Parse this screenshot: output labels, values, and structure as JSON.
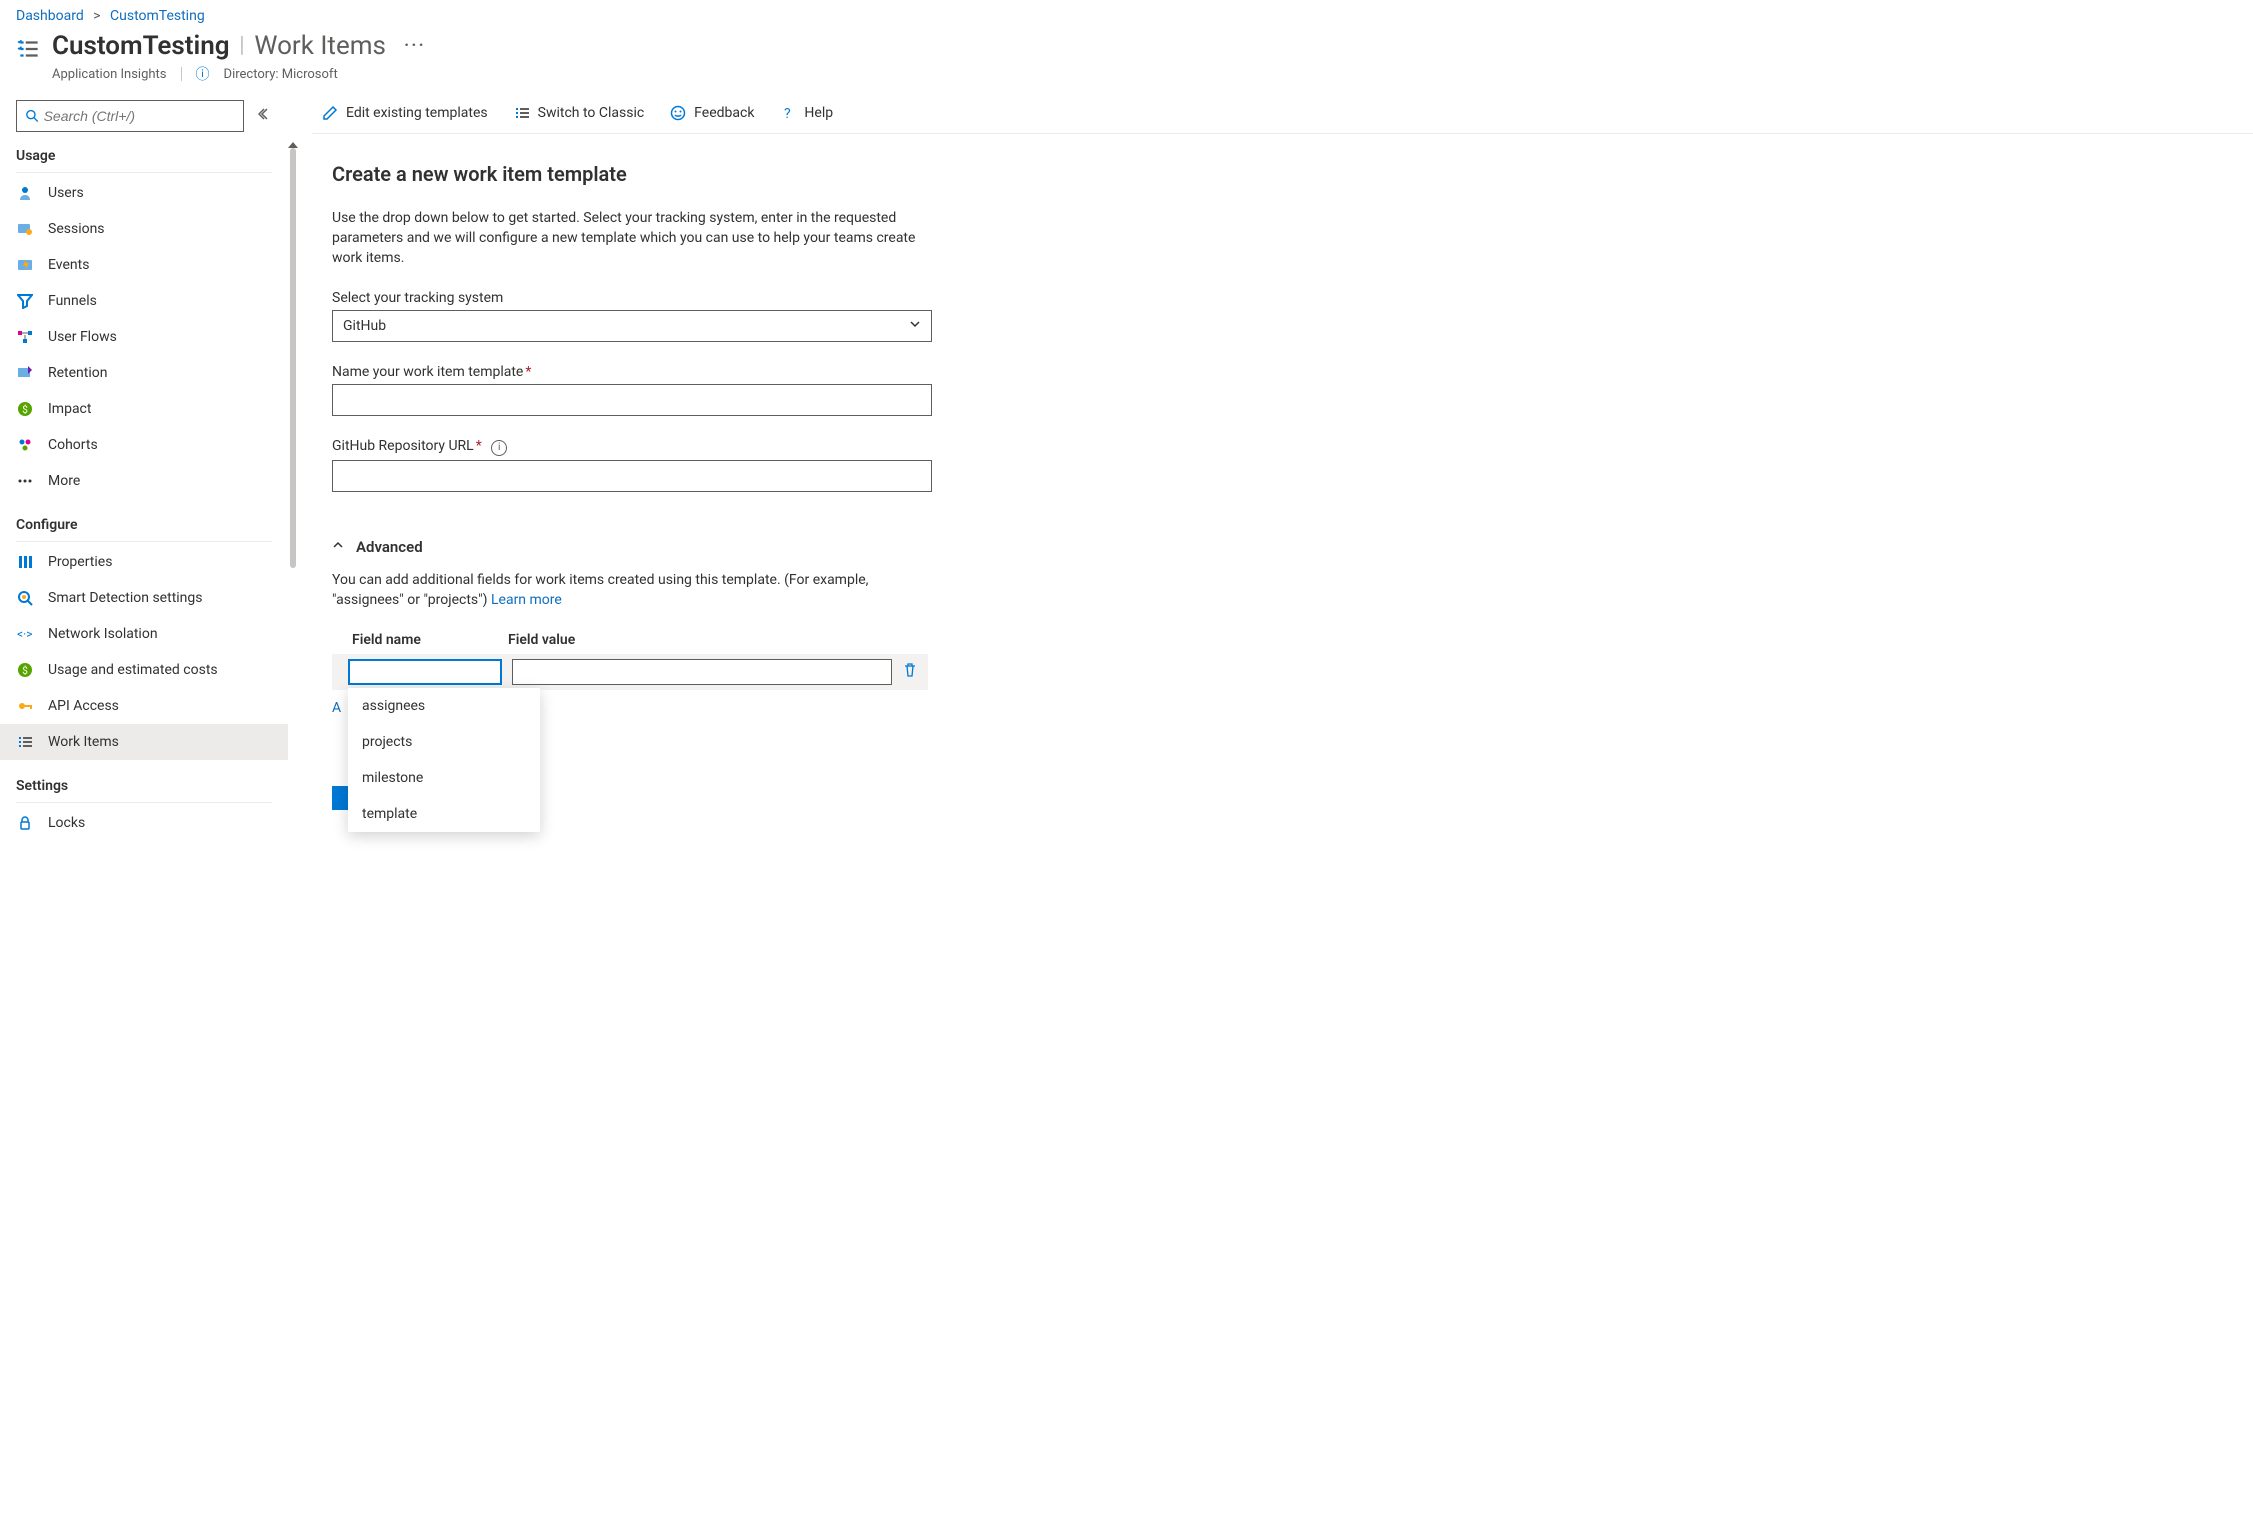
{
  "breadcrumb": {
    "root": "Dashboard",
    "current": "CustomTesting"
  },
  "header": {
    "resourceName": "CustomTesting",
    "bladeName": "Work Items",
    "resourceType": "Application Insights",
    "directoryLabel": "Directory: Microsoft"
  },
  "sidebar": {
    "searchPlaceholder": "Search (Ctrl+/)",
    "groups": {
      "usage": {
        "title": "Usage",
        "items": [
          "Users",
          "Sessions",
          "Events",
          "Funnels",
          "User Flows",
          "Retention",
          "Impact",
          "Cohorts",
          "More"
        ]
      },
      "configure": {
        "title": "Configure",
        "items": [
          "Properties",
          "Smart Detection settings",
          "Network Isolation",
          "Usage and estimated costs",
          "API Access",
          "Work Items"
        ]
      },
      "settings": {
        "title": "Settings",
        "items": [
          "Locks"
        ]
      }
    },
    "selected": "Work Items"
  },
  "toolbar": {
    "edit": "Edit existing templates",
    "classic": "Switch to Classic",
    "feedback": "Feedback",
    "help": "Help"
  },
  "content": {
    "title": "Create a new work item template",
    "intro": "Use the drop down below to get started. Select your tracking system, enter in the requested parameters and we will configure a new template which you can use to help your teams create work items.",
    "selectSystemLabel": "Select your tracking system",
    "selectSystemValue": "GitHub",
    "nameLabel": "Name your work item template",
    "repoLabel": "GitHub Repository URL"
  },
  "advanced": {
    "title": "Advanced",
    "desc": "You can add additional fields for work items created using this template. (For example, \"assignees\" or \"projects\") ",
    "learn": "Learn more",
    "col1": "Field name",
    "col2": "Field value",
    "addNew": "A",
    "dropdown": [
      "assignees",
      "projects",
      "milestone",
      "template"
    ]
  }
}
